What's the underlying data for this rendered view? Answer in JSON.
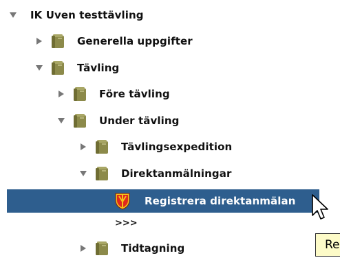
{
  "tree": {
    "root": {
      "label": "IK Uven testtävling",
      "expanded": true
    },
    "generella": {
      "label": "Generella uppgifter",
      "expanded": false
    },
    "tavling": {
      "label": "Tävling",
      "expanded": true
    },
    "fore": {
      "label": "Före tävling",
      "expanded": false
    },
    "under": {
      "label": "Under tävling",
      "expanded": true
    },
    "expedition": {
      "label": "Tävlingsexpedition",
      "expanded": false
    },
    "direktanmalningar": {
      "label": "Direktanmälningar",
      "expanded": true
    },
    "registrera": {
      "label": "Registrera direktanmälan",
      "selected": true
    },
    "more": {
      "label": ">>>"
    },
    "tidtagning": {
      "label": "Tidtagning",
      "expanded": false
    }
  },
  "tooltip": {
    "text": "Re"
  },
  "colors": {
    "selection": "#2e5e8e",
    "folder_body": "#8c8a4a",
    "crest_red": "#e0281e",
    "crest_yellow": "#f4c21a",
    "tooltip_bg": "#fdfbc8"
  },
  "icons": {
    "expanded": "triangle-down-icon",
    "collapsed": "triangle-right-icon",
    "folder": "binder-folder-icon",
    "item": "club-crest-icon",
    "pointer": "mouse-pointer-icon"
  }
}
